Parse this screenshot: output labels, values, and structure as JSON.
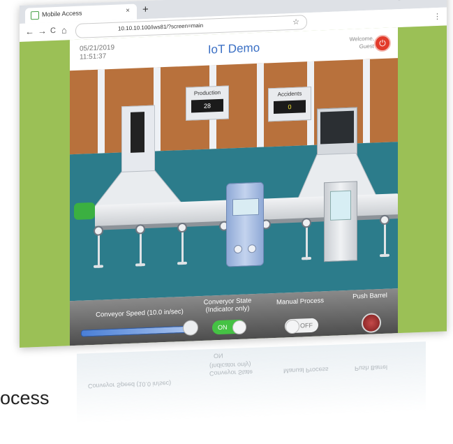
{
  "browser": {
    "tab_title": "Mobile Access",
    "tab_close": "×",
    "new_tab": "+",
    "window_controls": "– ☐ ✕",
    "nav_back": "←",
    "nav_forward": "→",
    "nav_reload": "C",
    "nav_home": "⌂",
    "url": "10.10.10.100/iws81/?screen=main",
    "star": "☆",
    "menu": "⋮"
  },
  "app": {
    "date": "05/21/2019",
    "time": "11:51:37",
    "title": "IoT Demo",
    "welcome_line1": "Welcome,",
    "welcome_line2": "Guest",
    "power_icon": "⏻",
    "accent_color": "#3a6fc4"
  },
  "counters": {
    "production": {
      "label": "Production",
      "value": "28",
      "color": "#ffffff"
    },
    "accidents": {
      "label": "Accidents",
      "value": "0",
      "color": "#f2e233"
    }
  },
  "controls": {
    "speed_label": "Conveyor Speed (10.0 in/sec)",
    "speed_level": 1.0,
    "state_label_line1": "Converyor State",
    "state_label_line2": "(Indicator only)",
    "state_toggle": "ON",
    "manual_label": "Manual Process",
    "manual_toggle": "OFF",
    "push_label": "Push Barrel"
  },
  "reflection": {
    "speed": "Conveyor Speed (10.0 in/sec)",
    "state1": "Conveyor State",
    "state2": "(Indicator only)",
    "manual": "Manual Process",
    "push": "Push Barrel",
    "toggle_on": "ON"
  },
  "caption": "ocess"
}
